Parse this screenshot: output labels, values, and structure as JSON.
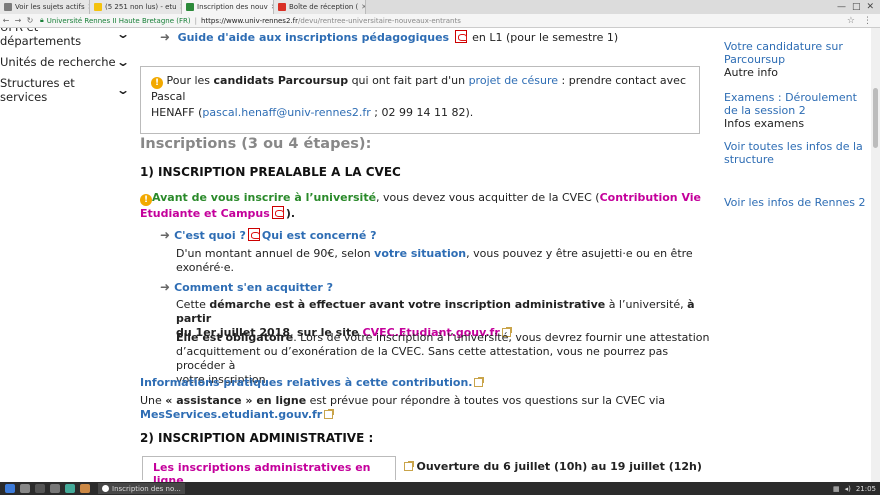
{
  "browser": {
    "tabs": [
      {
        "label": "Voir les sujets actifs",
        "color": "#7a7a7a"
      },
      {
        "label": "(5 251 non lus) - etu",
        "color": "#f4c20d"
      },
      {
        "label": "Inscription des nouv",
        "color": "#2c8a3a"
      },
      {
        "label": "Boîte de réception (",
        "color": "#d93025"
      }
    ],
    "secure_label": "Université Rennes II Haute Bretagne (FR)",
    "url_host": "https://www.univ-rennes2.fr",
    "url_path": "/devu/rentree-universitaire-nouveaux-entrants"
  },
  "leftnav": [
    "UFR et départements",
    "Unités de recherche",
    "Structures et services"
  ],
  "main": {
    "guide_link": "Guide d'aide aux inscriptions pédagogiques",
    "guide_suffix": "en L1 (pour le semestre 1)",
    "notice": {
      "t1": "Pour les ",
      "t2": "candidats Parcoursup",
      "t3": " qui ont fait part d'un ",
      "t4": "projet de césure",
      "t5": " : prendre contact avec Pascal",
      "t6": "HENAFF (",
      "t7": "pascal.henaff@univ-rennes2.fr",
      "t8": " ; 02 99 14 11 82)."
    },
    "section_title": "Inscriptions (3 ou 4 étapes):",
    "step1_title": "1) INSCRIPTION PREALABLE A LA CVEC",
    "warn1": {
      "green": "Avant de vous inscrire à l’université",
      "mid": ", vous devez vous acquitter de la CVEC (",
      "magenta1": "Contribution Vie",
      "magenta2": "Etudiante et Campus",
      "end": ")."
    },
    "cest_quoi": "C'est quoi ?",
    "qui_concerne": "Qui est concerné ?",
    "desc1": "D'un montant annuel de 90€, selon ",
    "desc1_link": "votre situation",
    "desc1_end": ", vous pouvez y être asujetti·e ou en être",
    "desc2": "exonéré·e.",
    "comment": "Comment s'en acquitter ?",
    "demarche": {
      "a": "Cette ",
      "b": "démarche est à effectuer avant votre inscription administrative",
      "c": " à l’université, ",
      "d": "à partir",
      "e": "du 1er juillet 2018",
      "f": ", ",
      "g": "sur le site ",
      "h": "CVEC.Etudiant.gouv.fr"
    },
    "oblig": {
      "a": "Elle est obligatoire",
      "b": ". Lors de votre inscription à l’université, vous devrez fournir une attestation",
      "c": "d’acquittement ou d’exonération de la CVEC. Sans cette attestation, vous ne pourrez pas procéder à",
      "d": "votre inscription."
    },
    "infos_link": "Informations pratiques relatives à cette contribution.",
    "assist": {
      "a": "Une ",
      "b": " « assistance » en ligne",
      "c": " est prévue pour répondre à toutes vos questions sur  la CVEC via",
      "d": "MesServices.etudiant.gouv.fr"
    },
    "step2_title": "2) INSCRIPTION ADMINISTRATIVE :",
    "insc_link": "Les inscriptions administratives en ligne",
    "ouverture": "Ouverture du 6 juillet (10h) au 19 juillet (12h)"
  },
  "right": {
    "links": [
      {
        "text": "Votre candidature sur Parcoursup",
        "sub": "Autre info"
      },
      {
        "text": "Examens : Déroulement de la session 2",
        "sub": "Infos examens"
      },
      {
        "text": "Voir toutes les infos de la structure",
        "sub": ""
      },
      {
        "text": "Voir les infos de Rennes 2",
        "sub": ""
      }
    ]
  },
  "taskbar": {
    "app_label": "Inscription des no...",
    "clock": "21:05"
  }
}
